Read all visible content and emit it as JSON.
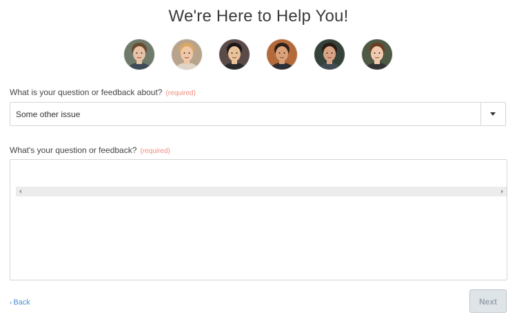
{
  "header": {
    "title": "We're Here to Help You!"
  },
  "team": {
    "avatars": [
      {
        "name": "avatar-1",
        "skin": "#e7c2a6",
        "hair": "#6b4b30",
        "bg": "#6f7a6a",
        "shirt": "#3e4a58"
      },
      {
        "name": "avatar-2",
        "skin": "#f0c8a8",
        "hair": "#d9a765",
        "bg": "#b8a48c",
        "shirt": "#e0d4c6"
      },
      {
        "name": "avatar-3",
        "skin": "#e9c29a",
        "hair": "#1c1716",
        "bg": "#5a4a48",
        "shirt": "#2a2a2a"
      },
      {
        "name": "avatar-4",
        "skin": "#d9a27a",
        "hair": "#2e1f18",
        "bg": "#b46a3a",
        "shirt": "#2b2e35"
      },
      {
        "name": "avatar-5",
        "skin": "#d9a485",
        "hair": "#2a1c14",
        "bg": "#35423a",
        "shirt": "#424a52"
      },
      {
        "name": "avatar-6",
        "skin": "#f1cbb0",
        "hair": "#6b3e24",
        "bg": "#4e5a44",
        "shirt": "#333333"
      }
    ]
  },
  "topic_field": {
    "label": "What is your question or feedback about?",
    "required": "(required)",
    "selected_value": "Some other issue"
  },
  "feedback_field": {
    "label": "What's your question or feedback?",
    "required": "(required)"
  },
  "nav": {
    "back_label": "Back",
    "back_chevron": "‹",
    "next_label": "Next"
  },
  "colors": {
    "required": "#f08a7c",
    "link": "#4a90d9",
    "button_disabled_bg": "#dfe4e9",
    "button_disabled_text": "#9aa3ac"
  }
}
